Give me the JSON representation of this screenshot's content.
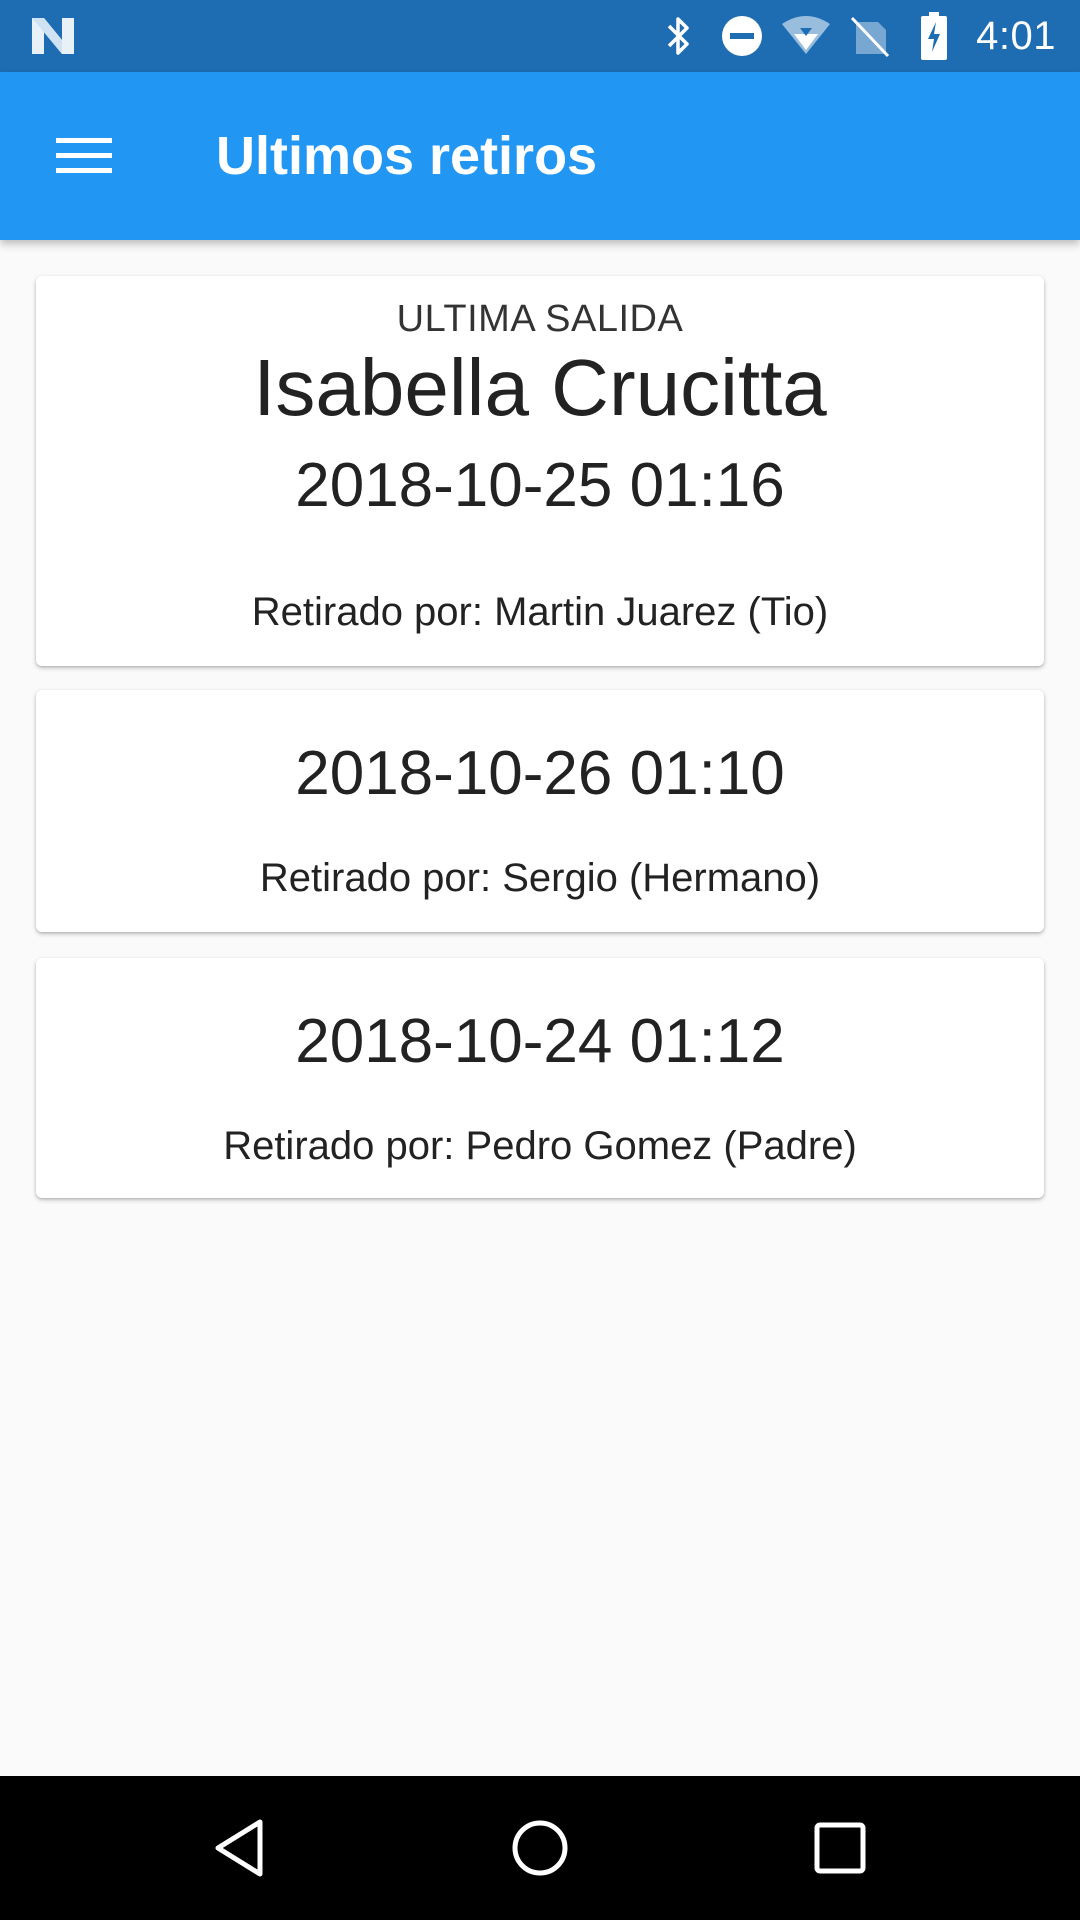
{
  "status_bar": {
    "time": "4:01",
    "icons": [
      "notification-n-icon",
      "bluetooth-icon",
      "do-not-disturb-icon",
      "wifi-icon",
      "no-sim-icon",
      "battery-charging-icon"
    ]
  },
  "app_bar": {
    "menu_icon": "hamburger-menu-icon",
    "title": "Ultimos retiros"
  },
  "cards": [
    {
      "label": "ULTIMA SALIDA",
      "name": "Isabella Crucitta",
      "datetime": "2018-10-25 01:16",
      "picked_up_by": "Retirado por: Martin Juarez (Tio)"
    },
    {
      "datetime": "2018-10-26 01:10",
      "picked_up_by": "Retirado por: Sergio (Hermano)"
    },
    {
      "datetime": "2018-10-24 01:12",
      "picked_up_by": "Retirado por: Pedro Gomez (Padre)"
    }
  ],
  "nav_bar": {
    "icons": [
      "back-icon",
      "home-icon",
      "recents-icon"
    ]
  },
  "colors": {
    "status_bar": "#1e6db3",
    "app_bar": "#2196f3",
    "background": "#fafafa",
    "nav_bar": "#000000"
  }
}
